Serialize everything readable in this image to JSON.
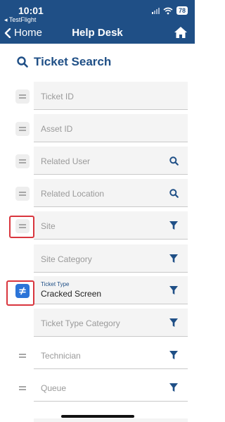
{
  "status_bar": {
    "time": "10:01",
    "back_app": "◂ TestFlight",
    "battery": "78"
  },
  "nav": {
    "back_label": "Home",
    "title": "Help Desk"
  },
  "page": {
    "title": "Ticket Search"
  },
  "fields": {
    "ticket_id": {
      "label": "Ticket ID"
    },
    "asset_id": {
      "label": "Asset ID"
    },
    "related_user": {
      "label": "Related User"
    },
    "related_location": {
      "label": "Related Location"
    },
    "site": {
      "label": "Site"
    },
    "site_category": {
      "label": "Site Category"
    },
    "ticket_type": {
      "label": "Ticket Type",
      "value": "Cracked Screen"
    },
    "ticket_type_category": {
      "label": "Ticket Type Category"
    },
    "technician": {
      "label": "Technician"
    },
    "queue": {
      "label": "Queue"
    }
  },
  "colors": {
    "brand": "#1f4f86",
    "active_operator": "#2b74d8",
    "highlight": "#d9363e"
  }
}
